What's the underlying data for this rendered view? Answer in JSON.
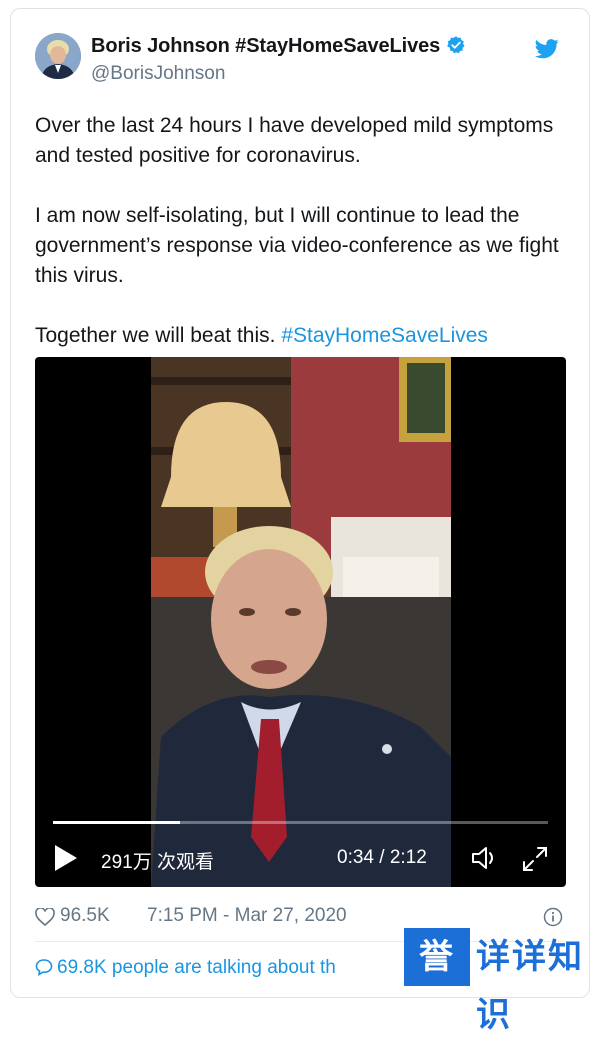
{
  "tweet": {
    "author_name": "Boris Johnson #StayHomeSaveLives",
    "handle": "@BorisJohnson",
    "paragraphs": [
      "Over the last 24 hours I have developed mild symptoms and tested positive for coronavirus.",
      "I am now self-isolating, but I will continue to lead the government’s response via video-conference as we fight this virus."
    ],
    "closing_text": "Together we will beat this.",
    "closing_hashtag": "#StayHomeSaveLives",
    "likes": "96.5K",
    "timestamp": "7:15 PM - Mar 27, 2020",
    "talking": "69.8K people are talking about th"
  },
  "video": {
    "views": "291万 次观看",
    "time": "0:34 / 2:12",
    "progress_fraction": 0.257
  },
  "watermark": {
    "box_text": "誉",
    "rest_text": "详详知识"
  },
  "colors": {
    "accent": "#1b95e0",
    "muted": "#657786"
  },
  "icons": [
    "verified-badge-icon",
    "twitter-bird-icon",
    "play-icon",
    "volume-icon",
    "fullscreen-icon",
    "heart-icon",
    "info-icon",
    "speech-bubble-icon"
  ]
}
